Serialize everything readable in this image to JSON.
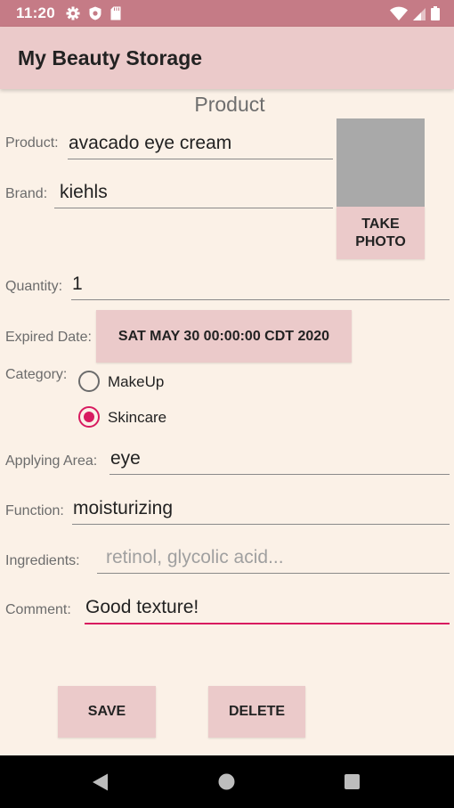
{
  "status_bar": {
    "time": "11:20",
    "left_icons": [
      "gear-icon",
      "shield-icon",
      "sd-card-icon"
    ],
    "right_icons": [
      "wifi-icon",
      "cell-signal-icon",
      "battery-icon"
    ]
  },
  "app_bar": {
    "title": "My Beauty Storage"
  },
  "form": {
    "section_title": "Product",
    "product": {
      "label": "Product:",
      "value": "avacado eye cream"
    },
    "brand": {
      "label": "Brand:",
      "value": "kiehls"
    },
    "take_photo_label": "TAKE\nPHOTO",
    "quantity": {
      "label": "Quantity:",
      "value": "1"
    },
    "expired_date": {
      "label": "Expired Date:",
      "value": "SAT MAY 30 00:00:00 CDT 2020"
    },
    "category": {
      "label": "Category:",
      "options": [
        {
          "label": "MakeUp",
          "checked": false
        },
        {
          "label": "Skincare",
          "checked": true
        }
      ]
    },
    "applying_area": {
      "label": "Applying Area:",
      "value": "eye"
    },
    "function": {
      "label": "Function:",
      "value": "moisturizing"
    },
    "ingredients": {
      "label": "Ingredients:",
      "value": "",
      "placeholder": "retinol, glycolic acid..."
    },
    "comment": {
      "label": "Comment:",
      "value": "Good texture!"
    },
    "save_label": "SAVE",
    "delete_label": "DELETE"
  },
  "colors": {
    "status_bar": "#c57b86",
    "app_bar": "#ebcaca",
    "background": "#fbf1e7",
    "accent": "#d81b60",
    "photo_placeholder": "#a9a9a9"
  },
  "nav_bar": {
    "icons": [
      "back-icon",
      "home-icon",
      "recents-icon"
    ]
  }
}
